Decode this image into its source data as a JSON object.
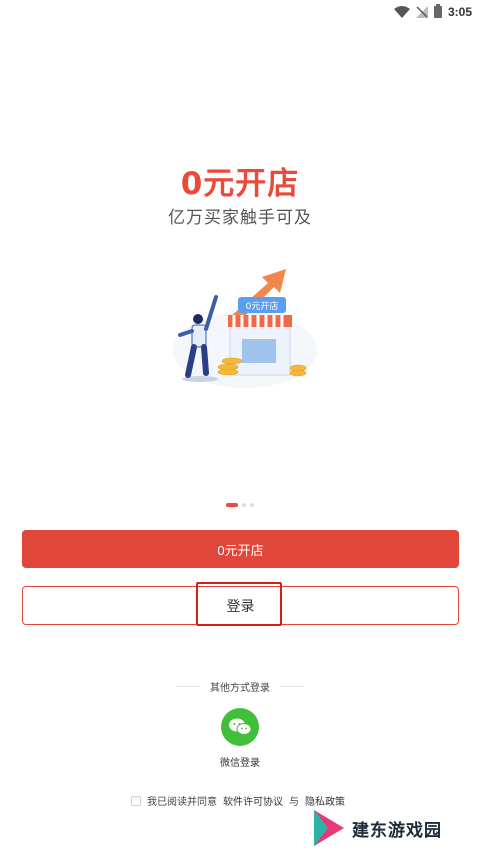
{
  "status_bar": {
    "time": "3:05"
  },
  "hero": {
    "headline": "0元开店",
    "subhead": "亿万买家触手可及",
    "sign_text": "0元开店"
  },
  "carousel": {
    "count": 3,
    "active_index": 0
  },
  "buttons": {
    "open_store": "0元开店",
    "login": "登录"
  },
  "other_login": {
    "title": "其他方式登录",
    "wechat_label": "微信登录"
  },
  "agreement": {
    "prefix": "我已阅读并同意",
    "license": "软件许可协议",
    "and": "与",
    "privacy": "隐私政策"
  },
  "watermark": {
    "text": "建东游戏园"
  },
  "colors": {
    "accent": "#e0463a",
    "headline": "#ea4a3a",
    "wechat": "#3fbf3a",
    "highlight": "#d4201b"
  }
}
